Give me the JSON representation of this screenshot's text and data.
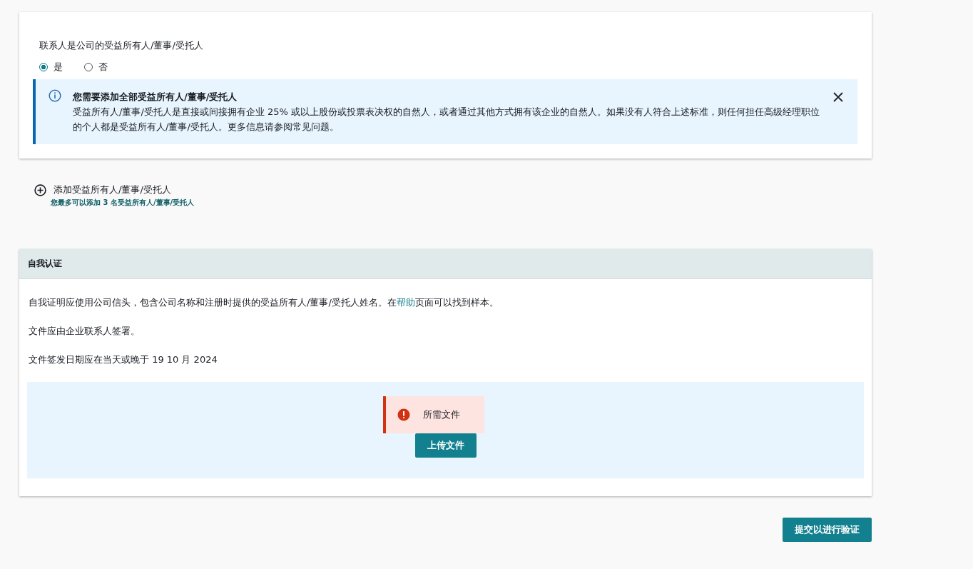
{
  "contact_question": {
    "label": "联系人是公司的受益所有人/董事/受托人",
    "options": [
      {
        "label": "是",
        "selected": true
      },
      {
        "label": "否",
        "selected": false
      }
    ]
  },
  "info_alert": {
    "title": "您需要添加全部受益所有人/董事/受托人",
    "body": "受益所有人/董事/受托人是直接或间接拥有企业 25% 或以上股份或投票表决权的自然人，或者通过其他方式拥有该企业的自然人。如果没有人符合上述标准，则任何担任高级经理职位的个人都是受益所有人/董事/受托人。更多信息请参阅常见问题。"
  },
  "add_owner": {
    "label": "添加受益所有人/董事/受托人",
    "hint": "您最多可以添加 3 名受益所有人/董事/受托人"
  },
  "self_certification": {
    "title": "自我认证",
    "intro_before": "自我证明应使用公司信头，包含公司名称和注册时提供的受益所有人/董事/受托人姓名。在",
    "intro_link": "帮助",
    "intro_after": "页面可以找到样本。",
    "signature_note": "文件应由企业联系人签署。",
    "date_note": "文件签发日期应在当天或晚于 19 10 月 2024",
    "error": "所需文件",
    "upload_button": "上传文件"
  },
  "submit_button": "提交以进行验证"
}
